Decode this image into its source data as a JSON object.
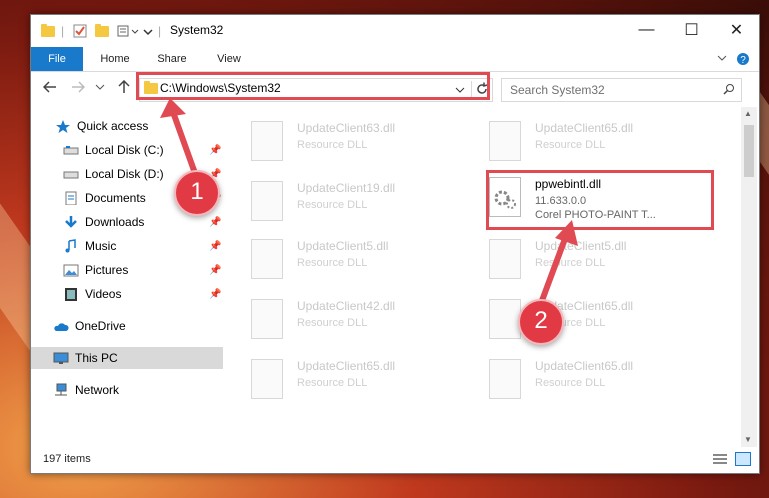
{
  "window": {
    "title": "System32"
  },
  "ribbon": {
    "tabs": [
      "File",
      "Home",
      "Share",
      "View"
    ]
  },
  "address": {
    "path": "C:\\Windows\\System32",
    "search_placeholder": "Search System32"
  },
  "sidebar": {
    "items": [
      {
        "label": "Quick access",
        "icon": "star-icon"
      },
      {
        "label": "Local Disk (C:)",
        "icon": "drive-icon"
      },
      {
        "label": "Local Disk (D:)",
        "icon": "drive-icon"
      },
      {
        "label": "Documents",
        "icon": "documents-icon"
      },
      {
        "label": "Downloads",
        "icon": "download-icon"
      },
      {
        "label": "Music",
        "icon": "music-icon"
      },
      {
        "label": "Pictures",
        "icon": "pictures-icon"
      },
      {
        "label": "Videos",
        "icon": "videos-icon"
      },
      {
        "label": "OneDrive",
        "icon": "cloud-icon"
      },
      {
        "label": "This PC",
        "icon": "pc-icon"
      },
      {
        "label": "Network",
        "icon": "network-icon"
      }
    ]
  },
  "files": [
    {
      "name": "UpdateClient63.dll",
      "type": "Resource DLL"
    },
    {
      "name": "UpdateClient65.dll",
      "type": "Resource DLL"
    },
    {
      "name": "UpdateClient19.dll",
      "type": "Resource DLL"
    },
    {
      "name": "ppwebintl.dll",
      "version": "11.633.0.0",
      "type": "Corel PHOTO-PAINT T..."
    },
    {
      "name": "UpdateClient5.dll",
      "type": "Resource DLL"
    },
    {
      "name": "UpdateClient5.dll",
      "type": "Resource DLL"
    },
    {
      "name": "UpdateClient42.dll",
      "type": "Resource DLL"
    },
    {
      "name": "UpdateClient65.dll",
      "type": "Resource DLL"
    },
    {
      "name": "UpdateClient65.dll",
      "type": "Resource DLL"
    },
    {
      "name": "UpdateClient65.dll",
      "type": "Resource DLL"
    }
  ],
  "status": {
    "count": "197 items"
  },
  "annotations": {
    "step1": "1",
    "step2": "2"
  },
  "colors": {
    "accent": "#1979ca",
    "highlight": "#e04a52"
  }
}
